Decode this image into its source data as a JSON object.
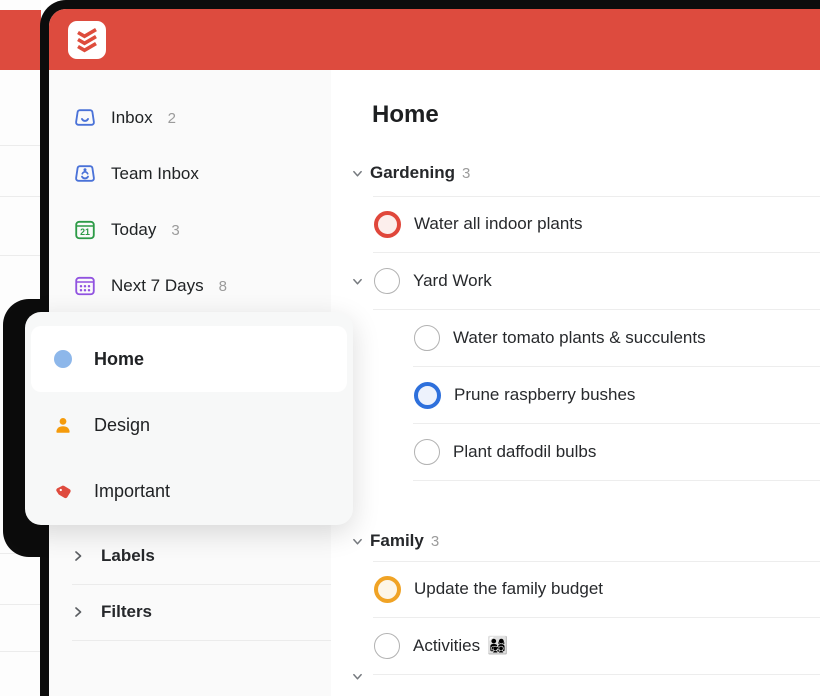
{
  "app": {
    "name": "Todoist"
  },
  "accents": {
    "header_red": "#dd4b3e",
    "frame_black": "#0c0c0c",
    "inbox_blue": "#4a72d8",
    "today_green": "#2c9a46",
    "next7_purple": "#9153e0",
    "design_orange": "#f59b0b",
    "important_red": "#df4b3e",
    "home_dot_blue": "#8db7ea",
    "priority_red": "#e0473b",
    "priority_blue": "#2e70dc",
    "priority_orange": "#f0a325"
  },
  "sidebar": {
    "items": [
      {
        "label": "Inbox",
        "count": "2",
        "icon": "inbox-icon"
      },
      {
        "label": "Team Inbox",
        "count": "",
        "icon": "team-inbox-icon"
      },
      {
        "label": "Today",
        "count": "3",
        "icon": "today-icon"
      },
      {
        "label": "Next 7 Days",
        "count": "8",
        "icon": "next-7-days-icon"
      }
    ],
    "groups": [
      {
        "label": "Labels"
      },
      {
        "label": "Filters"
      }
    ]
  },
  "popover": {
    "items": [
      {
        "label": "Home",
        "icon": "project-dot",
        "active": true
      },
      {
        "label": "Design",
        "icon": "person-icon",
        "active": false
      },
      {
        "label": "Important",
        "icon": "tag-icon",
        "active": false
      }
    ]
  },
  "main": {
    "title": "Home",
    "sections": [
      {
        "label": "Gardening",
        "count": "3"
      },
      {
        "label": "Family",
        "count": "3"
      }
    ],
    "tasks": {
      "water_plants": "Water all indoor plants",
      "yard_work": "Yard Work",
      "tomato": "Water tomato plants & succulents",
      "prune": "Prune raspberry bushes",
      "daffodil": "Plant daffodil bulbs",
      "budget": "Update the family budget",
      "activities": "Activities",
      "activities_emoji": "👨‍👩‍👧‍👦"
    },
    "today_number": "21"
  }
}
